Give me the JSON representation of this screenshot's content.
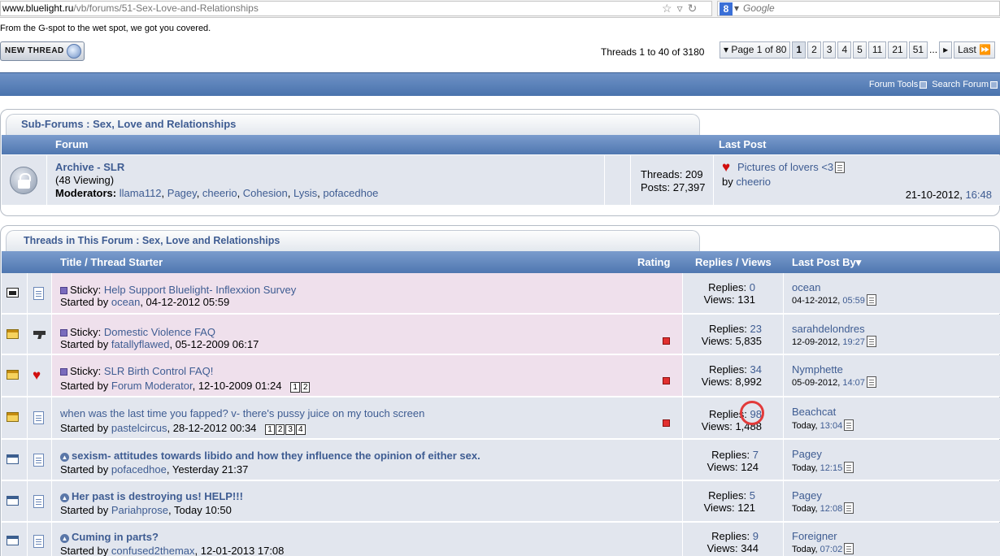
{
  "browser": {
    "url_host": "www.bluelight.ru",
    "url_path": "/vb/forums/51-Sex-Love-and-Relationships",
    "search_placeholder": "Google"
  },
  "tagline": "From the G-spot to the wet spot, we got you covered.",
  "new_thread_label": "NEW THREAD",
  "thread_count": "Threads 1 to 40 of 3180",
  "pager": {
    "page_label": "Page 1 of 80",
    "pages": [
      "1",
      "2",
      "3",
      "4",
      "5",
      "11",
      "21",
      "51"
    ],
    "ellipsis": "...",
    "last_label": "Last"
  },
  "toolbar": {
    "forum_tools": "Forum Tools",
    "search_forum": "Search Forum"
  },
  "subforums": {
    "title": "Sub-Forums : Sex, Love and Relationships",
    "col_forum": "Forum",
    "col_last_post": "Last Post",
    "forum": {
      "name": "Archive - SLR",
      "viewing": "(48 Viewing)",
      "moderators_label": "Moderators:",
      "moderators": [
        "llama112",
        "Pagey",
        "cheerio",
        "Cohesion",
        "Lysis",
        "pofacedhoe"
      ],
      "threads": "Threads: 209",
      "posts": "Posts: 27,397",
      "last_post_title": "Pictures of lovers <3",
      "last_post_by_label": "by",
      "last_post_by": "cheerio",
      "last_post_date": "21-10-2012,",
      "last_post_time": "16:48"
    }
  },
  "threads_block": {
    "title": "Threads in This Forum : Sex, Love and Relationships",
    "col_title": "Title / Thread Starter",
    "col_rating": "Rating",
    "col_replies": "Replies / Views",
    "col_lastpost": "Last Post By",
    "rows": [
      {
        "prefix": "Sticky:",
        "title": "Help Support Bluelight- Inflexxion Survey",
        "starter": "ocean",
        "started": "04-12-2012 05:59",
        "replies": "0",
        "views": "131",
        "lp_user": "ocean",
        "lp_date": "04-12-2012,",
        "lp_time": "05:59",
        "pages": []
      },
      {
        "prefix": "Sticky:",
        "title": "Domestic Violence FAQ",
        "starter": "fatallyflawed",
        "started": "05-12-2009 06:17",
        "replies": "23",
        "views": "5,835",
        "lp_user": "sarahdelondres",
        "lp_date": "12-09-2012,",
        "lp_time": "19:27",
        "pages": []
      },
      {
        "prefix": "Sticky:",
        "title": "SLR Birth Control FAQ!",
        "starter": "Forum Moderator",
        "started": "12-10-2009 01:24",
        "replies": "34",
        "views": "8,992",
        "lp_user": "Nymphette",
        "lp_date": "05-09-2012,",
        "lp_time": "14:07",
        "pages": [
          "1",
          "2"
        ]
      },
      {
        "prefix": "",
        "title": "when was the last time you fapped? v- there's pussy juice on my touch screen",
        "starter": "pastelcircus",
        "started": "28-12-2012 00:34",
        "replies": "98",
        "views": "1,488",
        "lp_user": "Beachcat",
        "lp_date": "Today,",
        "lp_time": "13:04",
        "pages": [
          "1",
          "2",
          "3",
          "4"
        ]
      },
      {
        "prefix": "",
        "title": "sexism- attitudes towards libido and how they influence the opinion of either sex.",
        "starter": "pofacedhoe",
        "started": "Yesterday 21:37",
        "replies": "7",
        "views": "124",
        "lp_user": "Pagey",
        "lp_date": "Today,",
        "lp_time": "12:15",
        "pages": []
      },
      {
        "prefix": "",
        "title": "Her past is destroying us! HELP!!!",
        "starter": "Pariahprose",
        "started": "Today 10:50",
        "replies": "5",
        "views": "121",
        "lp_user": "Pagey",
        "lp_date": "Today,",
        "lp_time": "12:08",
        "pages": []
      },
      {
        "prefix": "",
        "title": "Cuming in parts?",
        "starter": "confused2themax",
        "started": "12-01-2013 17:08",
        "replies": "9",
        "views": "344",
        "lp_user": "Foreigner",
        "lp_date": "Today,",
        "lp_time": "07:02",
        "pages": []
      }
    ],
    "started_by_label": "Started by",
    "replies_label": "Replies:",
    "views_label": "Views:"
  }
}
